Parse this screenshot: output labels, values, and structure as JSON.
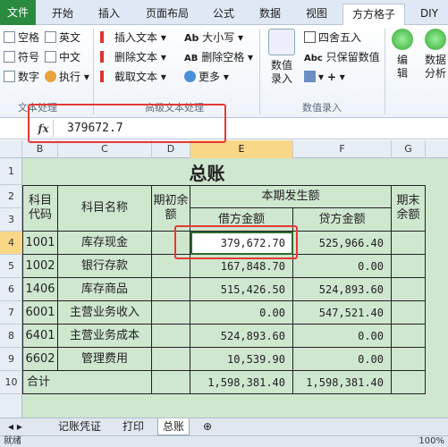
{
  "tabs": {
    "file": "文件",
    "home": "开始",
    "insert": "插入",
    "page_layout": "页面布局",
    "formulas": "公式",
    "data": "数据",
    "view": "视图",
    "fangfang": "方方格子",
    "diy": "DIY"
  },
  "ribbon": {
    "space": "空格",
    "english": "英文",
    "symbol": "符号",
    "chinese": "中文",
    "number": "数字",
    "execute": "执行",
    "insert_text": "插入文本",
    "delete_text": "删除文本",
    "cut_text": "截取文本",
    "case": "大小写",
    "delete_space": "删除空格",
    "more": "更多",
    "round": "四舍五入",
    "keep_value": "只保留数值",
    "number_entry_l1": "数值",
    "number_entry_l2": "录入",
    "edit": "编",
    "edit2": "辑",
    "data_l1": "数据",
    "data_l2": "分析",
    "group_text": "文本处理",
    "group_advanced": "高级文本处理",
    "group_number": "数值录入"
  },
  "formula_bar": {
    "fx": "fx",
    "value": "379672.7"
  },
  "columns": [
    "B",
    "C",
    "D",
    "E",
    "F",
    "G"
  ],
  "rows": [
    "1",
    "2",
    "3",
    "4",
    "5",
    "6",
    "7",
    "8",
    "9",
    "10"
  ],
  "sheet": {
    "title": "总账",
    "h_code": "科目代码",
    "h_name": "科目名称",
    "h_opening": "期初余额",
    "h_period": "本期发生额",
    "h_debit": "借方金额",
    "h_credit": "贷方金额",
    "h_closing": "期末余额",
    "data": [
      {
        "code": "1001",
        "name": "库存现金",
        "debit": "379,672.70",
        "credit": "525,966.40"
      },
      {
        "code": "1002",
        "name": "银行存款",
        "debit": "167,848.70",
        "credit": "0.00"
      },
      {
        "code": "1406",
        "name": "库存商品",
        "debit": "515,426.50",
        "credit": "524,893.60"
      },
      {
        "code": "6001",
        "name": "主营业务收入",
        "debit": "0.00",
        "credit": "547,521.40"
      },
      {
        "code": "6401",
        "name": "主营业务成本",
        "debit": "524,893.60",
        "credit": "0.00"
      },
      {
        "code": "6602",
        "name": "管理费用",
        "debit": "10,539.90",
        "credit": "0.00"
      }
    ],
    "total_label": "合计",
    "total_debit": "1,598,381.40",
    "total_credit": "1,598,381.40"
  },
  "sheet_tabs": {
    "t1": "记账凭证",
    "t2": "打印",
    "t3": "总账"
  },
  "status": {
    "left": "就绪",
    "zoom": "100%"
  },
  "colors": {
    "sheet_bg": "#cfe6cf",
    "highlight": "#e53935",
    "file_tab": "#2a8a3e"
  }
}
